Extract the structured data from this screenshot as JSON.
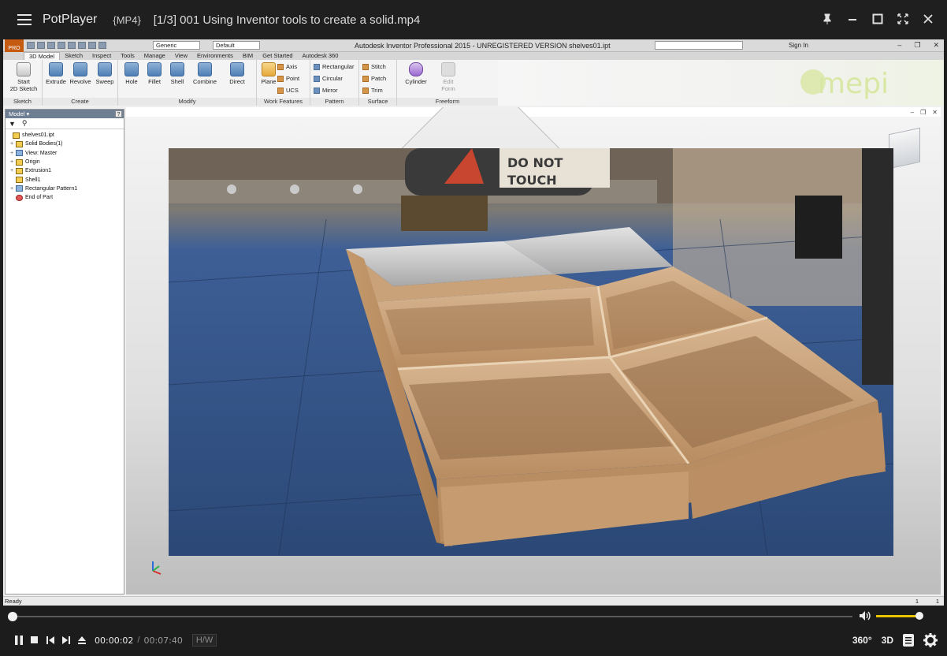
{
  "player": {
    "app_name": "PotPlayer",
    "format": "{MP4}",
    "file_title": "[1/3] 001 Using Inventor tools to create a solid.mp4",
    "time_current": "00:00:02",
    "time_separator": "/",
    "time_duration": "00:07:40",
    "hw_label": "H/W",
    "progress_fraction": 0.005,
    "volume_fraction": 0.95,
    "btn_360": "360°",
    "btn_3d": "3D",
    "accent_color": "#e8c300"
  },
  "inventor": {
    "title": "Autodesk Inventor Professional 2015 - UNREGISTERED VERSION     shelves01.ipt",
    "qat_select_1": "Generic",
    "qat_select_2": "Default",
    "sign_in": "Sign In",
    "logo_text": "PRO",
    "tabs": [
      "3D Model",
      "Sketch",
      "Inspect",
      "Tools",
      "Manage",
      "View",
      "Environments",
      "BIM",
      "Get Started",
      "Autodesk 360"
    ],
    "ribbon": {
      "sketch": {
        "label": "Sketch",
        "start": "Start",
        "start2": "2D Sketch"
      },
      "create": {
        "label": "Create",
        "extrude": "Extrude",
        "revolve": "Revolve",
        "sweep": "Sweep"
      },
      "modify": {
        "label": "Modify",
        "hole": "Hole",
        "fillet": "Fillet",
        "shell": "Shell",
        "combine": "Combine",
        "direct": "Direct"
      },
      "work": {
        "label": "Work Features",
        "plane": "Plane",
        "axis": "Axis",
        "point": "Point",
        "ucs": "UCS"
      },
      "pattern": {
        "label": "Pattern",
        "rectangular": "Rectangular",
        "circular": "Circular",
        "mirror": "Mirror"
      },
      "surface": {
        "label": "Surface",
        "stitch": "Stitch",
        "patch": "Patch",
        "trim": "Trim"
      },
      "freeform": {
        "label": "Freeform",
        "cylinder": "Cylinder",
        "edit": "Edit",
        "form": "Form"
      }
    },
    "banner_text": "mepi",
    "browser": {
      "header": "Model",
      "help": "?",
      "items": [
        {
          "label": "shelves01.ipt",
          "icon": "part-icon"
        },
        {
          "label": "Solid Bodies(1)",
          "icon": "folder-icon"
        },
        {
          "label": "View: Master",
          "icon": "view-icon"
        },
        {
          "label": "Origin",
          "icon": "folder-icon"
        },
        {
          "label": "Extrusion1",
          "icon": "extrusion-icon"
        },
        {
          "label": "Shell1",
          "icon": "shell-icon"
        },
        {
          "label": "Rectangular Pattern1",
          "icon": "pattern-icon"
        },
        {
          "label": "End of Part",
          "icon": "end-icon"
        }
      ]
    },
    "status_ready": "Ready",
    "status_count_1": "1",
    "status_count_2": "1",
    "video_overlay_text": "DO NOT TOUCH"
  }
}
